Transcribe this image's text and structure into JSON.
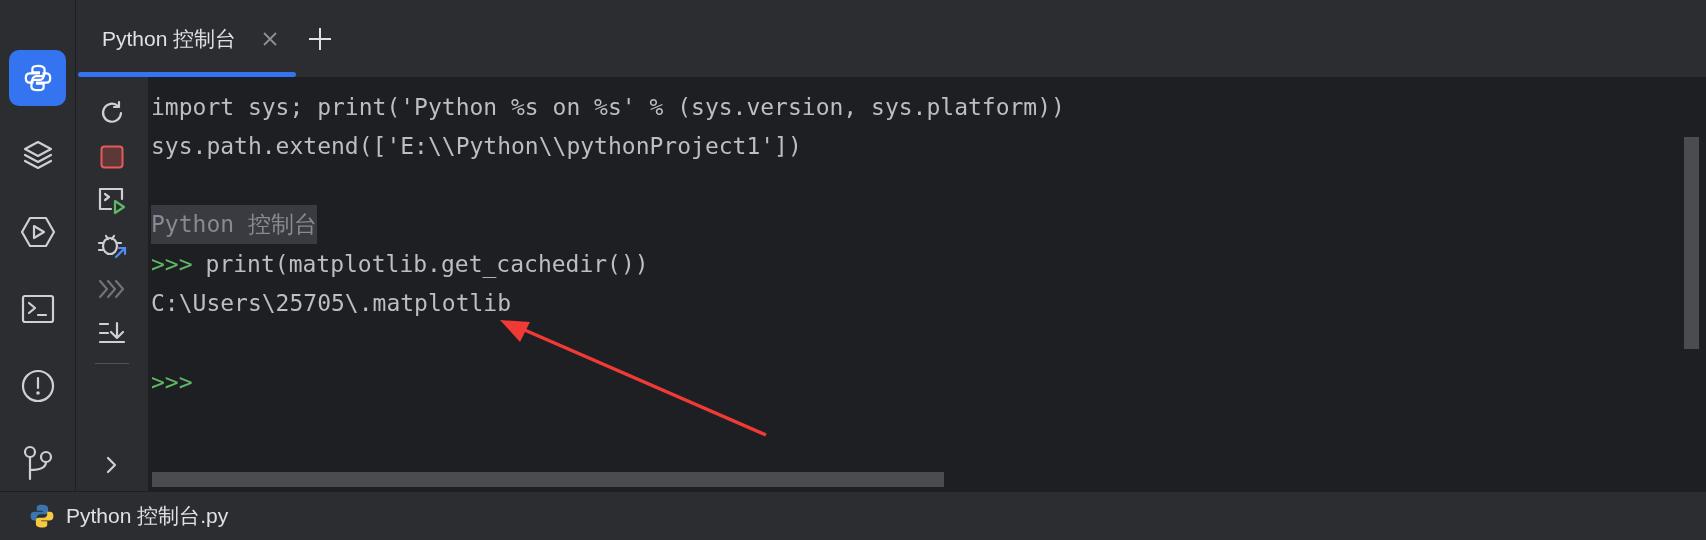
{
  "rail": [
    {
      "kind": "python",
      "selected": true
    },
    {
      "kind": "layers",
      "selected": false
    },
    {
      "kind": "run",
      "selected": false
    },
    {
      "kind": "terminal",
      "selected": false
    },
    {
      "kind": "problems",
      "selected": false
    },
    {
      "kind": "git",
      "selected": false
    }
  ],
  "tabs": [
    {
      "label": "Python 控制台",
      "selected": true
    }
  ],
  "toolbar": [
    {
      "kind": "rerun",
      "disabled": false
    },
    {
      "kind": "stop",
      "disabled": false
    },
    {
      "kind": "console-run",
      "disabled": false
    },
    {
      "kind": "debug",
      "disabled": false
    },
    {
      "kind": "chevrons",
      "disabled": true
    },
    {
      "kind": "scroll-end",
      "disabled": false
    }
  ],
  "console": {
    "lines": [
      {
        "kind": "code",
        "text": "import sys; print('Python %s on %s' % (sys.version, sys.platform))"
      },
      {
        "kind": "code",
        "text": "sys.path.extend(['E:\\\\Python\\\\pythonProject1'])"
      },
      {
        "kind": "blank"
      },
      {
        "kind": "header",
        "text": "Python 控制台"
      },
      {
        "kind": "prompt",
        "prompt": ">>>",
        "text": "print(matplotlib.get_cachedir())"
      },
      {
        "kind": "output",
        "text": "C:\\Users\\25705\\.matplotlib"
      },
      {
        "kind": "blank"
      },
      {
        "kind": "prompt",
        "prompt": ">>>"
      }
    ]
  },
  "status_bar": {
    "file": "Python 控制台.py"
  }
}
